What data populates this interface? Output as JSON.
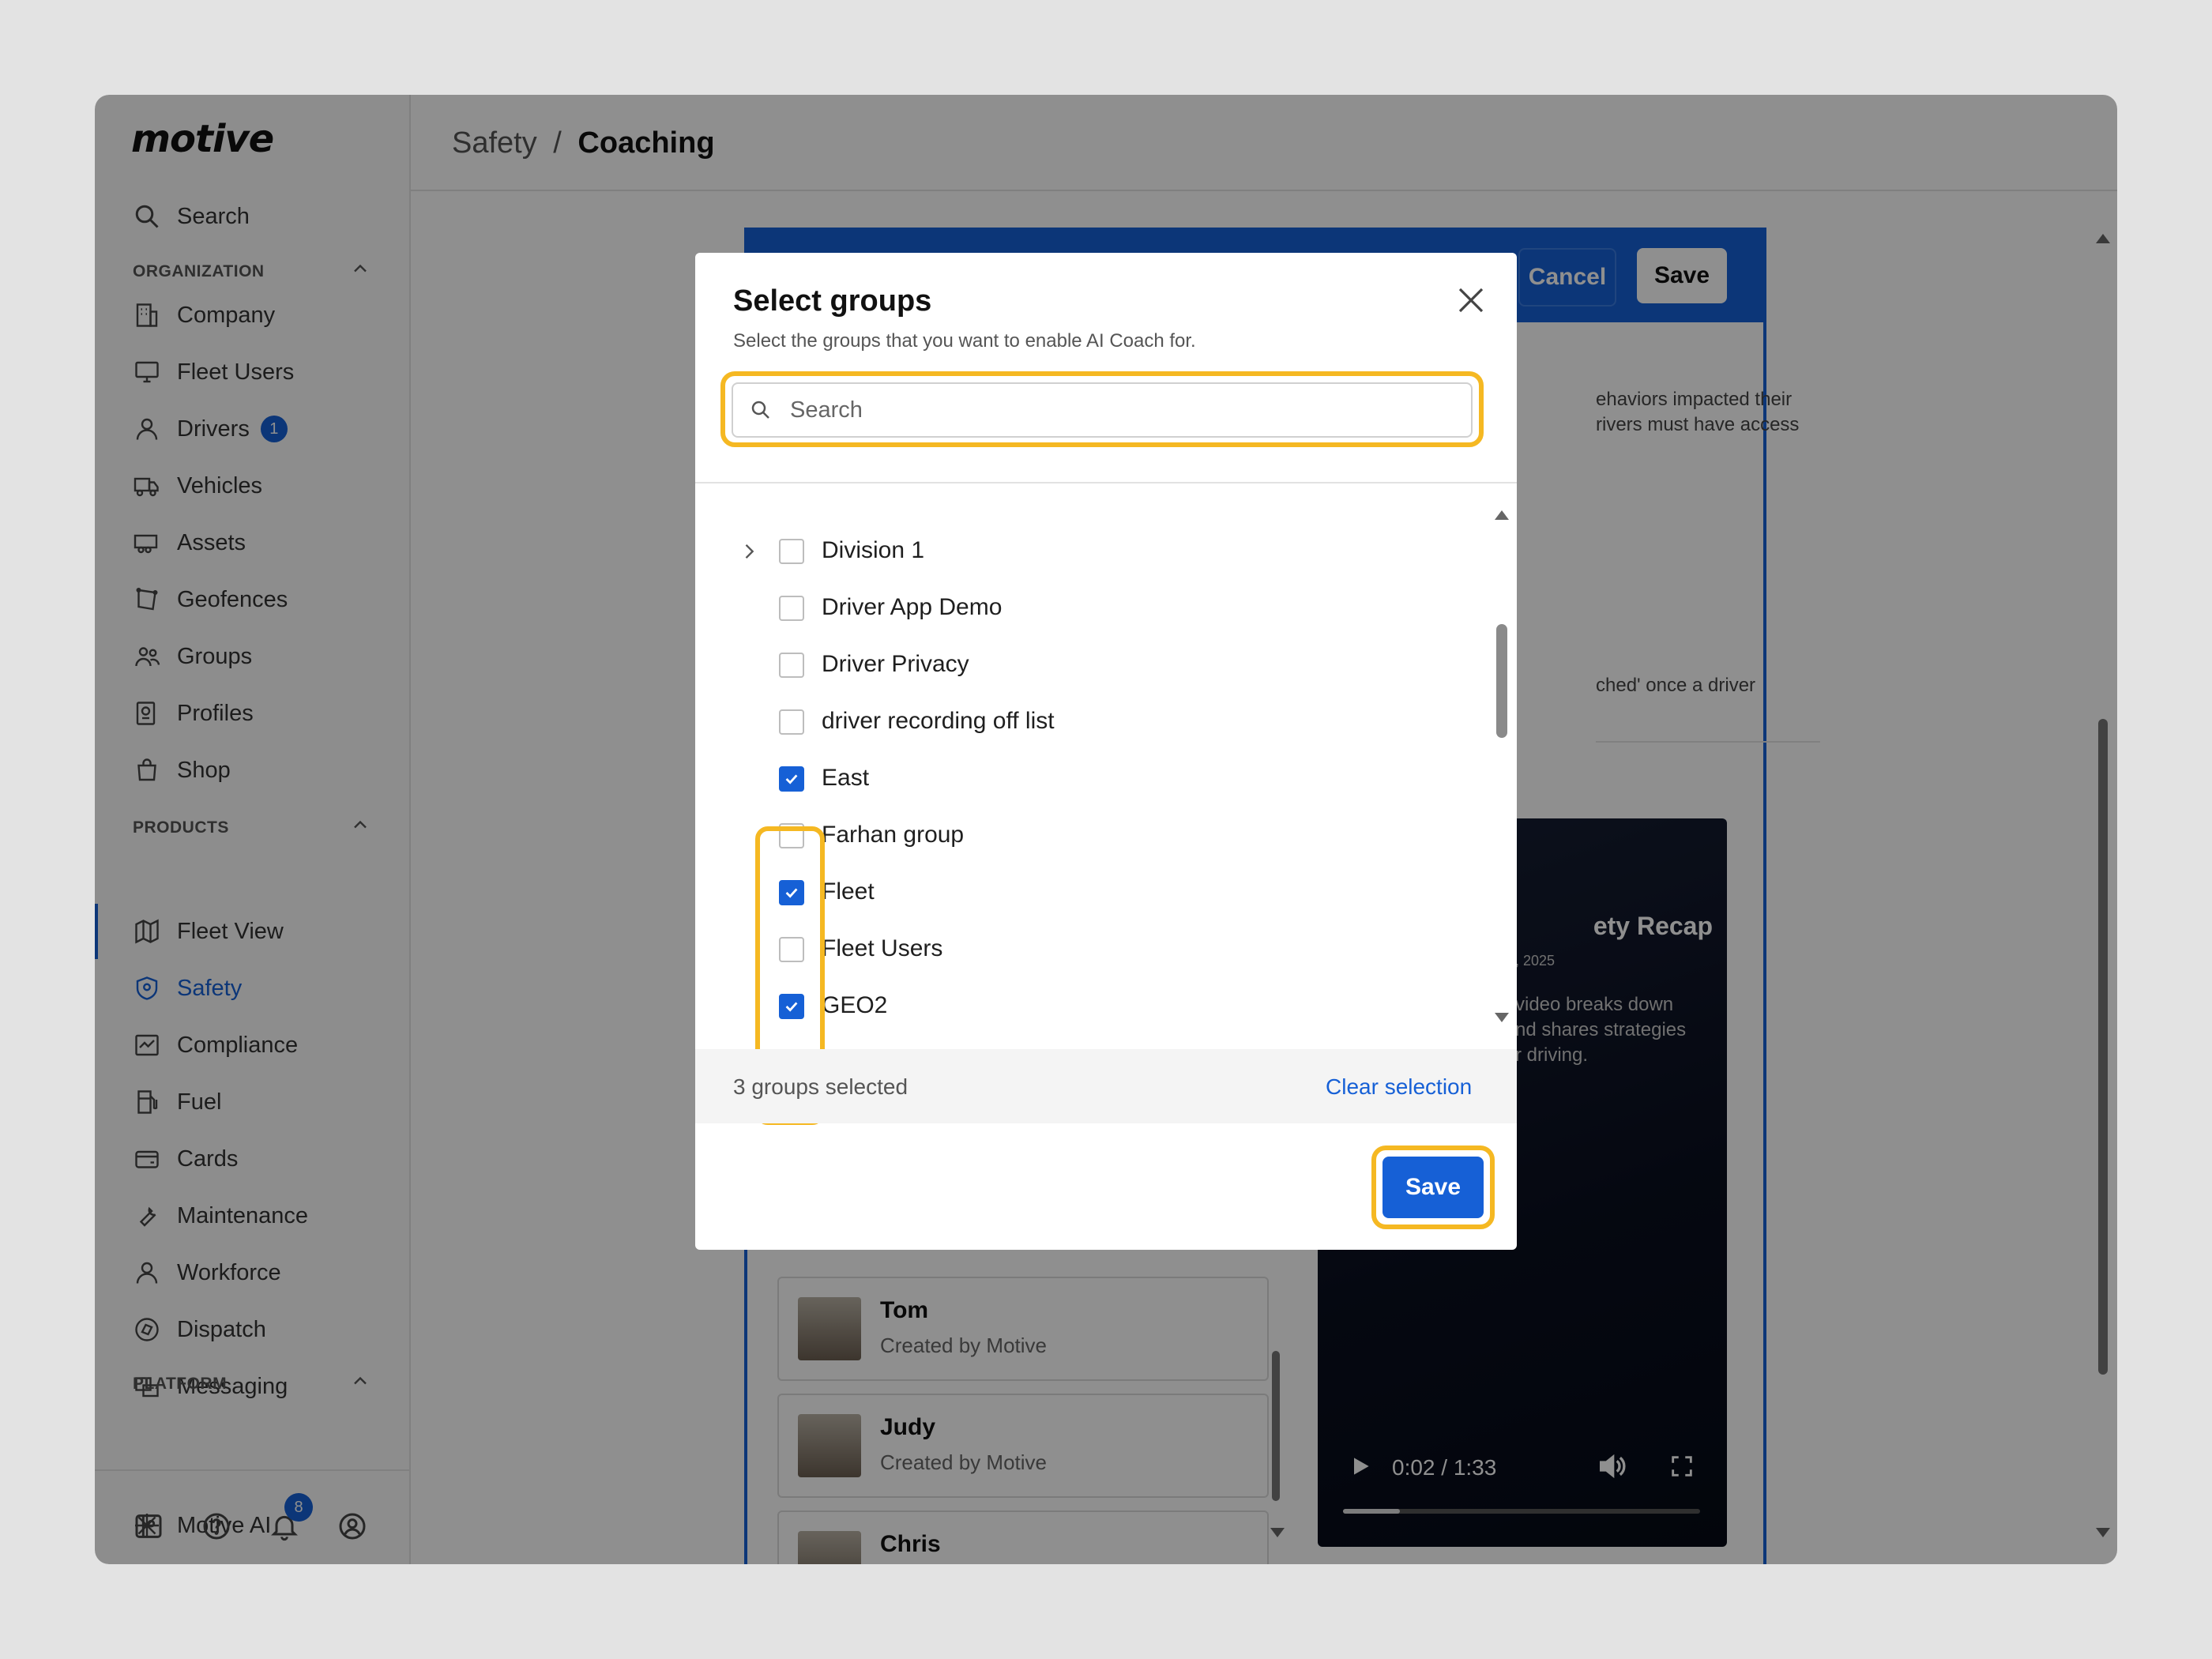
{
  "app": {
    "logo": "motive"
  },
  "header": {
    "breadcrumb_parent": "Safety",
    "breadcrumb_sep": "/",
    "breadcrumb_current": "Coaching"
  },
  "sidebar": {
    "search_label": "Search",
    "sections": {
      "organization": "ORGANIZATION",
      "products": "PRODUCTS",
      "platform": "PLATFORM"
    },
    "org_items": [
      {
        "label": "Company",
        "icon": "building-icon"
      },
      {
        "label": "Fleet Users",
        "icon": "monitor-icon"
      },
      {
        "label": "Drivers",
        "icon": "person-icon",
        "badge": "1"
      },
      {
        "label": "Vehicles",
        "icon": "truck-icon"
      },
      {
        "label": "Assets",
        "icon": "trailer-icon"
      },
      {
        "label": "Geofences",
        "icon": "geofence-icon"
      },
      {
        "label": "Groups",
        "icon": "groups-icon"
      },
      {
        "label": "Profiles",
        "icon": "profile-gear-icon"
      },
      {
        "label": "Shop",
        "icon": "shop-bag-icon"
      }
    ],
    "product_items": [
      {
        "label": "Fleet View",
        "icon": "map-icon"
      },
      {
        "label": "Safety",
        "icon": "shield-icon",
        "active": true
      },
      {
        "label": "Compliance",
        "icon": "compliance-icon"
      },
      {
        "label": "Fuel",
        "icon": "fuel-icon"
      },
      {
        "label": "Cards",
        "icon": "card-icon"
      },
      {
        "label": "Maintenance",
        "icon": "wrench-icon"
      },
      {
        "label": "Workforce",
        "icon": "person-icon"
      },
      {
        "label": "Dispatch",
        "icon": "dispatch-icon"
      },
      {
        "label": "Messaging",
        "icon": "messaging-icon"
      }
    ],
    "platform_items": [
      {
        "label": "Motive AI",
        "icon": "sparkle-icon"
      }
    ],
    "footer": {
      "notification_count": "8"
    }
  },
  "background": {
    "cancel_label": "Cancel",
    "save_label": "Save",
    "text_line1": "ehaviors impacted their",
    "text_line2": "rivers must have access",
    "text_line3": "ched' once a driver",
    "video": {
      "title": "ety Recap",
      "date": "7, 2025",
      "desc_line1": "video breaks down",
      "desc_line2": "nd shares strategies",
      "desc_line3": "r driving.",
      "time": "0:02 / 1:33",
      "progress": 0.16
    },
    "coaches": [
      {
        "name": "Tom",
        "sub": "Created by Motive"
      },
      {
        "name": "Judy",
        "sub": "Created by Motive"
      },
      {
        "name": "Chris",
        "sub": ""
      }
    ]
  },
  "modal": {
    "title": "Select groups",
    "subtitle": "Select the groups that you want to enable AI Coach for.",
    "search_placeholder": "Search",
    "groups": [
      {
        "label": "Division 1",
        "checked": false,
        "expandable": true
      },
      {
        "label": "Driver App Demo",
        "checked": false
      },
      {
        "label": "Driver Privacy",
        "checked": false
      },
      {
        "label": "driver recording off list",
        "checked": false
      },
      {
        "label": "East",
        "checked": true
      },
      {
        "label": "Farhan group",
        "checked": false
      },
      {
        "label": "Fleet",
        "checked": true
      },
      {
        "label": "Fleet Users",
        "checked": false
      },
      {
        "label": "GEO2",
        "checked": true
      }
    ],
    "selected_count": "3 groups selected",
    "clear_label": "Clear selection",
    "save_label": "Save"
  },
  "colors": {
    "accent": "#1660d6",
    "highlight": "#f5b822"
  }
}
